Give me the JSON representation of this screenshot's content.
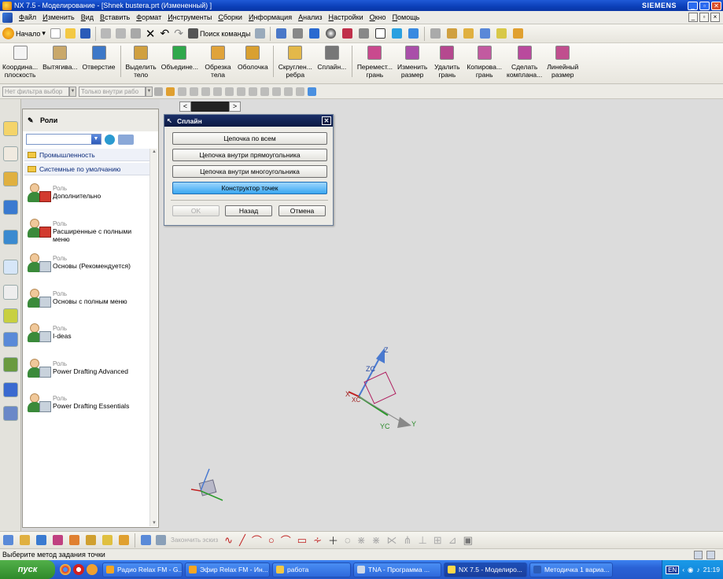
{
  "window": {
    "title": "NX 7.5 - Моделирование - [Shnek bustera.prt (Измененный) ]",
    "brand": "SIEMENS",
    "controls": [
      "_",
      "▫",
      "✕"
    ]
  },
  "menu": {
    "items": [
      "Файл",
      "Изменить",
      "Вид",
      "Вставить",
      "Формат",
      "Инструменты",
      "Сборки",
      "Информация",
      "Анализ",
      "Настройки",
      "Окно",
      "Помощь"
    ]
  },
  "toolbar1": {
    "start_label": "Начало",
    "search_label": "Поиск команды"
  },
  "toolbar2": {
    "buttons": [
      {
        "label": "Координа...\nплоскость",
        "icon": "datum-plane-icon",
        "color": "#f4f4f4"
      },
      {
        "label": "Вытягива...",
        "icon": "extrude-icon",
        "color": "#c9a86a"
      },
      {
        "label": "Отверстие",
        "icon": "hole-icon",
        "color": "#3d78c8"
      },
      {
        "label": "Выделить\nтело",
        "icon": "extract-body-icon",
        "color": "#d0a040"
      },
      {
        "label": "Объедине...",
        "icon": "unite-icon",
        "color": "#2fa84b"
      },
      {
        "label": "Обрезка\nтела",
        "icon": "trim-body-icon",
        "color": "#e0a33a"
      },
      {
        "label": "Оболочка",
        "icon": "shell-icon",
        "color": "#d9a030"
      },
      {
        "label": "Скруглен...\nребра",
        "icon": "edge-blend-icon",
        "color": "#e3b84a"
      },
      {
        "label": "Сплайн...",
        "icon": "spline-icon",
        "color": "#777777"
      },
      {
        "label": "Перемест...\nгрань",
        "icon": "move-face-icon",
        "color": "#c94a8e"
      },
      {
        "label": "Изменить\nразмер",
        "icon": "resize-face-icon",
        "color": "#a94fa9"
      },
      {
        "label": "Удалить\nгрань",
        "icon": "delete-face-icon",
        "color": "#b5488f"
      },
      {
        "label": "Копирова...\nгрань",
        "icon": "copy-face-icon",
        "color": "#c25aa0"
      },
      {
        "label": "Сделать\nкомплана...",
        "icon": "make-coplanar-icon",
        "color": "#b94a9d"
      },
      {
        "label": "Линейный\nразмер",
        "icon": "linear-dimension-icon",
        "color": "#c04f8e"
      }
    ]
  },
  "toolbar3": {
    "filter_type": "Нет фильтра выбор",
    "filter_scope": "Только внутри рабо"
  },
  "roles_panel": {
    "title": "Роли",
    "folders": [
      "Промышленность",
      "Системные по умолчанию"
    ],
    "roles": [
      {
        "kind": "Роль",
        "name": "Дополнительно",
        "variant": "red"
      },
      {
        "kind": "Роль",
        "name": "Расширенные с полными меню",
        "variant": "red"
      },
      {
        "kind": "Роль",
        "name": "Основы (Рекомендуется)",
        "variant": "gray"
      },
      {
        "kind": "Роль",
        "name": "Основы с полным меню",
        "variant": "gray"
      },
      {
        "kind": "Роль",
        "name": "I-deas",
        "variant": "gray"
      },
      {
        "kind": "Роль",
        "name": "Power Drafting Advanced",
        "variant": "gray"
      },
      {
        "kind": "Роль",
        "name": "Power Drafting Essentials",
        "variant": "gray"
      }
    ]
  },
  "canvas": {
    "tabs": [
      "<",
      ">"
    ],
    "axes_labels": {
      "z": "Z",
      "zc": "ZC",
      "y": "Y",
      "yc": "YC",
      "x": "X",
      "xc": "XC"
    }
  },
  "spline_dialog": {
    "title": "Сплайн",
    "options": [
      "Цепочка по всем",
      "Цепочка внутри прямоугольника",
      "Цепочка внутри многоугольника",
      "Конструктор точек"
    ],
    "ok": "OK",
    "back": "Назад",
    "cancel": "Отмена"
  },
  "bottom_toolbar": {
    "finish_sketch": "Закончить эскиз"
  },
  "status": {
    "text": "Выберите метод задания точки"
  },
  "taskbar": {
    "start": "пуск",
    "tasks": [
      {
        "label": "Радио Relax FM - G...",
        "color": "#f5a623"
      },
      {
        "label": "Эфир Relax FM - Ин...",
        "color": "#f5a623"
      },
      {
        "label": "работа",
        "color": "#f3c844"
      },
      {
        "label": "TNA - Программа ...",
        "color": "#cfd8e6"
      },
      {
        "label": "NX 7.5 - Моделиро...",
        "color": "#ffd84a"
      },
      {
        "label": "Методичка 1 вариа...",
        "color": "#2b5cb8"
      }
    ],
    "tray_lang": "EN",
    "clock": "21:19"
  }
}
